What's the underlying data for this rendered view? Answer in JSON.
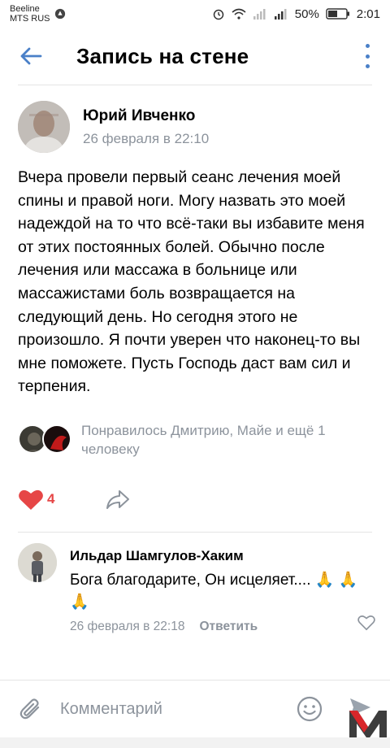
{
  "status_bar": {
    "carrier_1": "Beeline",
    "carrier_2": "MTS RUS",
    "battery": "50%",
    "time": "2:01"
  },
  "header": {
    "title": "Запись на стене"
  },
  "post": {
    "author_name": "Юрий Ивченко",
    "date": "26 февраля в 22:10",
    "text": "Вчера провели первый сеанс лечения моей спины и правой ноги. Могу назвать это моей надеждой на то что всё-таки вы избавите меня от этих постоянных болей. Обычно после лечения или массажа в больнице или массажистами боль возвращается на следующий день. Но сегодня этого не произошло. Я почти уверен что наконец-то вы мне поможете. Пусть Господь даст вам сил и терпения.",
    "likes_text": "Понравилось Дмитрию, Майе и ещё 1 человеку",
    "like_count": "4"
  },
  "comment": {
    "author_name": "Ильдар Шамгулов-Хаким",
    "text": "Бога благодарите, Он исцеляет.... 🙏 🙏🙏",
    "date": "26 февраля в 22:18",
    "reply_label": "Ответить"
  },
  "composer": {
    "placeholder": "Комментарий"
  },
  "colors": {
    "accent": "#4a80c8",
    "like_red": "#e64646",
    "secondary_text": "#8c939c"
  },
  "icons": [
    "back-arrow-icon",
    "more-vertical-icon",
    "heart-icon",
    "share-icon",
    "heart-outline-icon",
    "paperclip-icon",
    "smile-icon",
    "send-icon"
  ]
}
